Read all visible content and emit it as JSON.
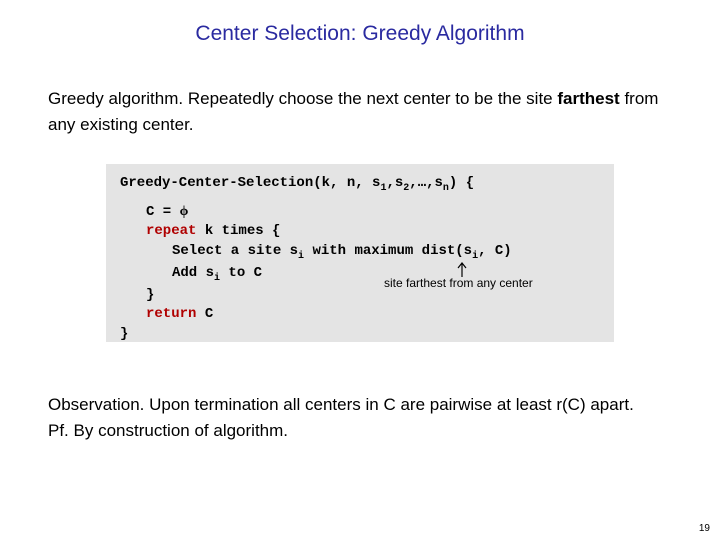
{
  "title": "Center Selection:  Greedy Algorithm",
  "intro_prefix": "Greedy algorithm.  Repeatedly choose the next center to be the site ",
  "intro_strong": "farthest",
  "intro_suffix": " from any existing center.",
  "code": {
    "fn_name": "Greedy-Center-Selection(k, n, s",
    "fn_args_tail": ") {",
    "args_subs": [
      "1",
      "2",
      "n"
    ],
    "c_eq": "C = ",
    "phi": "ϕ",
    "repeat_kw": "repeat",
    "repeat_tail": " k times {",
    "select_line_a": "Select a site s",
    "select_line_b": " with maximum dist(s",
    "select_line_c": ", C)",
    "sub_i": "i",
    "add_line_a": "Add s",
    "add_line_b": " to C",
    "close_brace": "}",
    "return_kw": "return",
    "return_tail": " C",
    "outer_close": "}"
  },
  "annotation": "site farthest from any center",
  "obs_label": "Observation.",
  "obs_text": " Upon termination all centers in C are pairwise at least r(C) apart.",
  "pf_label": "Pf.",
  "pf_text": "  By construction of algorithm.",
  "page_number": "19"
}
